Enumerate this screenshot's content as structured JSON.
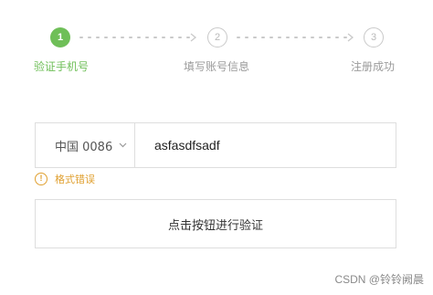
{
  "steps": [
    {
      "number": "1",
      "label": "验证手机号",
      "state": "active"
    },
    {
      "number": "2",
      "label": "填写账号信息",
      "state": "inactive"
    },
    {
      "number": "3",
      "label": "注册成功",
      "state": "inactive"
    }
  ],
  "phone": {
    "country_code": "中国 0086",
    "value": "asfasdfsadf"
  },
  "error": {
    "icon_text": "!",
    "message": "格式错误"
  },
  "verify_button": {
    "label": "点击按钮进行验证"
  },
  "watermark": "CSDN @铃铃阙晨",
  "colors": {
    "active": "#6fbf58",
    "inactive": "#c9c9c9",
    "error": "#e0a030",
    "border": "#dedede"
  },
  "icons": {
    "connector": "dotted-arrow",
    "country_dropdown": "chevron-down-icon",
    "error": "warning-circle-icon"
  }
}
